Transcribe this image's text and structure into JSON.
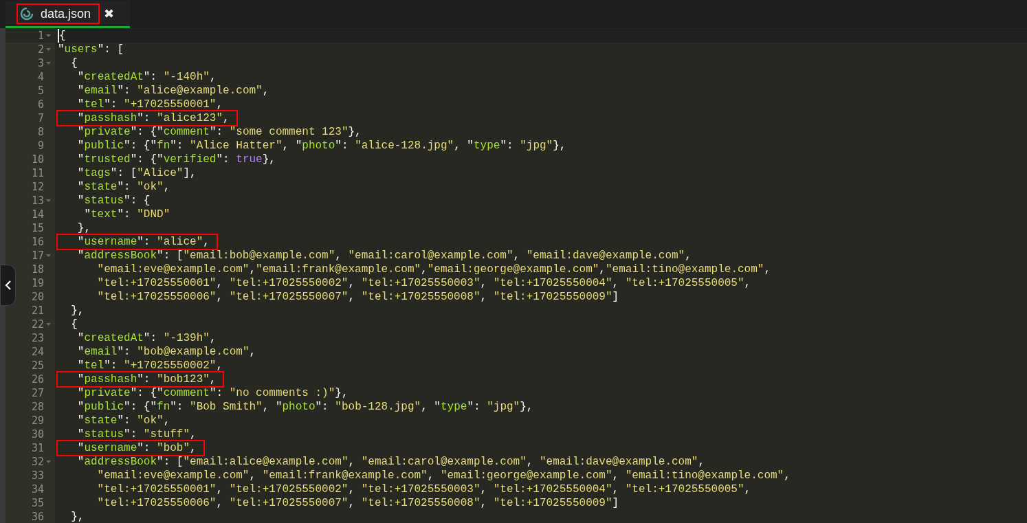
{
  "tab": {
    "title": "data.json",
    "selected": true,
    "highlighted": true,
    "close": "✖"
  },
  "editor": {
    "lines": [
      {
        "number": "1",
        "text": "{",
        "foldable": true,
        "current": true,
        "highlighted": false
      },
      {
        "number": "2",
        "text": "\"users\": [",
        "foldable": true,
        "current": false,
        "highlighted": false
      },
      {
        "number": "3",
        "text": "  {",
        "foldable": true,
        "current": false,
        "highlighted": false
      },
      {
        "number": "4",
        "text": "   \"createdAt\": \"-140h\",",
        "current": false,
        "highlighted": false
      },
      {
        "number": "5",
        "text": "   \"email\": \"alice@example.com\",",
        "current": false,
        "highlighted": false
      },
      {
        "number": "6",
        "text": "   \"tel\": \"+17025550001\",",
        "current": false,
        "highlighted": false
      },
      {
        "number": "7",
        "text": "   \"passhash\": \"alice123\",",
        "current": false,
        "highlighted": true
      },
      {
        "number": "8",
        "text": "   \"private\": {\"comment\": \"some comment 123\"},",
        "current": false,
        "highlighted": false
      },
      {
        "number": "9",
        "text": "   \"public\": {\"fn\": \"Alice Hatter\", \"photo\": \"alice-128.jpg\", \"type\": \"jpg\"},",
        "current": false,
        "highlighted": false
      },
      {
        "number": "10",
        "text": "   \"trusted\": {\"verified\": true},",
        "current": false,
        "highlighted": false
      },
      {
        "number": "11",
        "text": "   \"tags\": [\"Alice\"],",
        "current": false,
        "highlighted": false
      },
      {
        "number": "12",
        "text": "   \"state\": \"ok\",",
        "current": false,
        "highlighted": false
      },
      {
        "number": "13",
        "text": "   \"status\": {",
        "foldable": true,
        "current": false,
        "highlighted": false
      },
      {
        "number": "14",
        "text": "    \"text\": \"DND\"",
        "current": false,
        "highlighted": false
      },
      {
        "number": "15",
        "text": "   },",
        "current": false,
        "highlighted": false
      },
      {
        "number": "16",
        "text": "   \"username\": \"alice\",",
        "current": false,
        "highlighted": true
      },
      {
        "number": "17",
        "text": "   \"addressBook\": [\"email:bob@example.com\", \"email:carol@example.com\", \"email:dave@example.com\",",
        "foldable": true,
        "current": false,
        "highlighted": false
      },
      {
        "number": "18",
        "text": "      \"email:eve@example.com\",\"email:frank@example.com\",\"email:george@example.com\",\"email:tino@example.com\",",
        "current": false,
        "highlighted": false
      },
      {
        "number": "19",
        "text": "      \"tel:+17025550001\", \"tel:+17025550002\", \"tel:+17025550003\", \"tel:+17025550004\", \"tel:+17025550005\",",
        "current": false,
        "highlighted": false
      },
      {
        "number": "20",
        "text": "      \"tel:+17025550006\", \"tel:+17025550007\", \"tel:+17025550008\", \"tel:+17025550009\"]",
        "current": false,
        "highlighted": false
      },
      {
        "number": "21",
        "text": "  },",
        "current": false,
        "highlighted": false
      },
      {
        "number": "22",
        "text": "  {",
        "foldable": true,
        "current": false,
        "highlighted": false
      },
      {
        "number": "23",
        "text": "   \"createdAt\": \"-139h\",",
        "current": false,
        "highlighted": false
      },
      {
        "number": "24",
        "text": "   \"email\": \"bob@example.com\",",
        "current": false,
        "highlighted": false
      },
      {
        "number": "25",
        "text": "   \"tel\": \"+17025550002\",",
        "current": false,
        "highlighted": false
      },
      {
        "number": "26",
        "text": "   \"passhash\": \"bob123\",",
        "current": false,
        "highlighted": true
      },
      {
        "number": "27",
        "text": "   \"private\": {\"comment\": \"no comments :)\"},",
        "current": false,
        "highlighted": false
      },
      {
        "number": "28",
        "text": "   \"public\": {\"fn\": \"Bob Smith\", \"photo\": \"bob-128.jpg\", \"type\": \"jpg\"},",
        "current": false,
        "highlighted": false
      },
      {
        "number": "29",
        "text": "   \"state\": \"ok\",",
        "current": false,
        "highlighted": false
      },
      {
        "number": "30",
        "text": "   \"status\": \"stuff\",",
        "current": false,
        "highlighted": false
      },
      {
        "number": "31",
        "text": "   \"username\": \"bob\",",
        "current": false,
        "highlighted": true
      },
      {
        "number": "32",
        "text": "   \"addressBook\": [\"email:alice@example.com\", \"email:carol@example.com\", \"email:dave@example.com\",",
        "foldable": true,
        "current": false,
        "highlighted": false
      },
      {
        "number": "33",
        "text": "      \"email:eve@example.com\", \"email:frank@example.com\", \"email:george@example.com\", \"email:tino@example.com\",",
        "current": false,
        "highlighted": false
      },
      {
        "number": "34",
        "text": "      \"tel:+17025550001\", \"tel:+17025550002\", \"tel:+17025550003\", \"tel:+17025550004\", \"tel:+17025550005\",",
        "current": false,
        "highlighted": false
      },
      {
        "number": "35",
        "text": "      \"tel:+17025550006\", \"tel:+17025550007\", \"tel:+17025550008\", \"tel:+17025550009\"]",
        "current": false,
        "highlighted": false
      },
      {
        "number": "36",
        "text": "  },",
        "current": false,
        "highlighted": false
      }
    ]
  }
}
